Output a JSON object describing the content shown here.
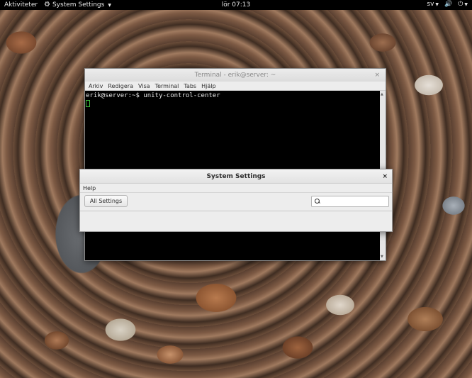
{
  "topbar": {
    "activities": "Aktiviteter",
    "app_icon": "gear-icon",
    "app_name": "System Settings",
    "clock": "lör 07:13",
    "language": "sv",
    "indicators": [
      "volume-icon",
      "power-icon"
    ]
  },
  "terminal": {
    "title": "Terminal - erik@server: ~",
    "close": "×",
    "menu": [
      "Arkiv",
      "Redigera",
      "Visa",
      "Terminal",
      "Tabs",
      "Hjälp"
    ],
    "prompt_line": "erik@server:~$ unity-control-center"
  },
  "settings": {
    "title": "System Settings",
    "close": "×",
    "menu": [
      "Help"
    ],
    "all_settings_label": "All Settings",
    "search_placeholder": ""
  }
}
